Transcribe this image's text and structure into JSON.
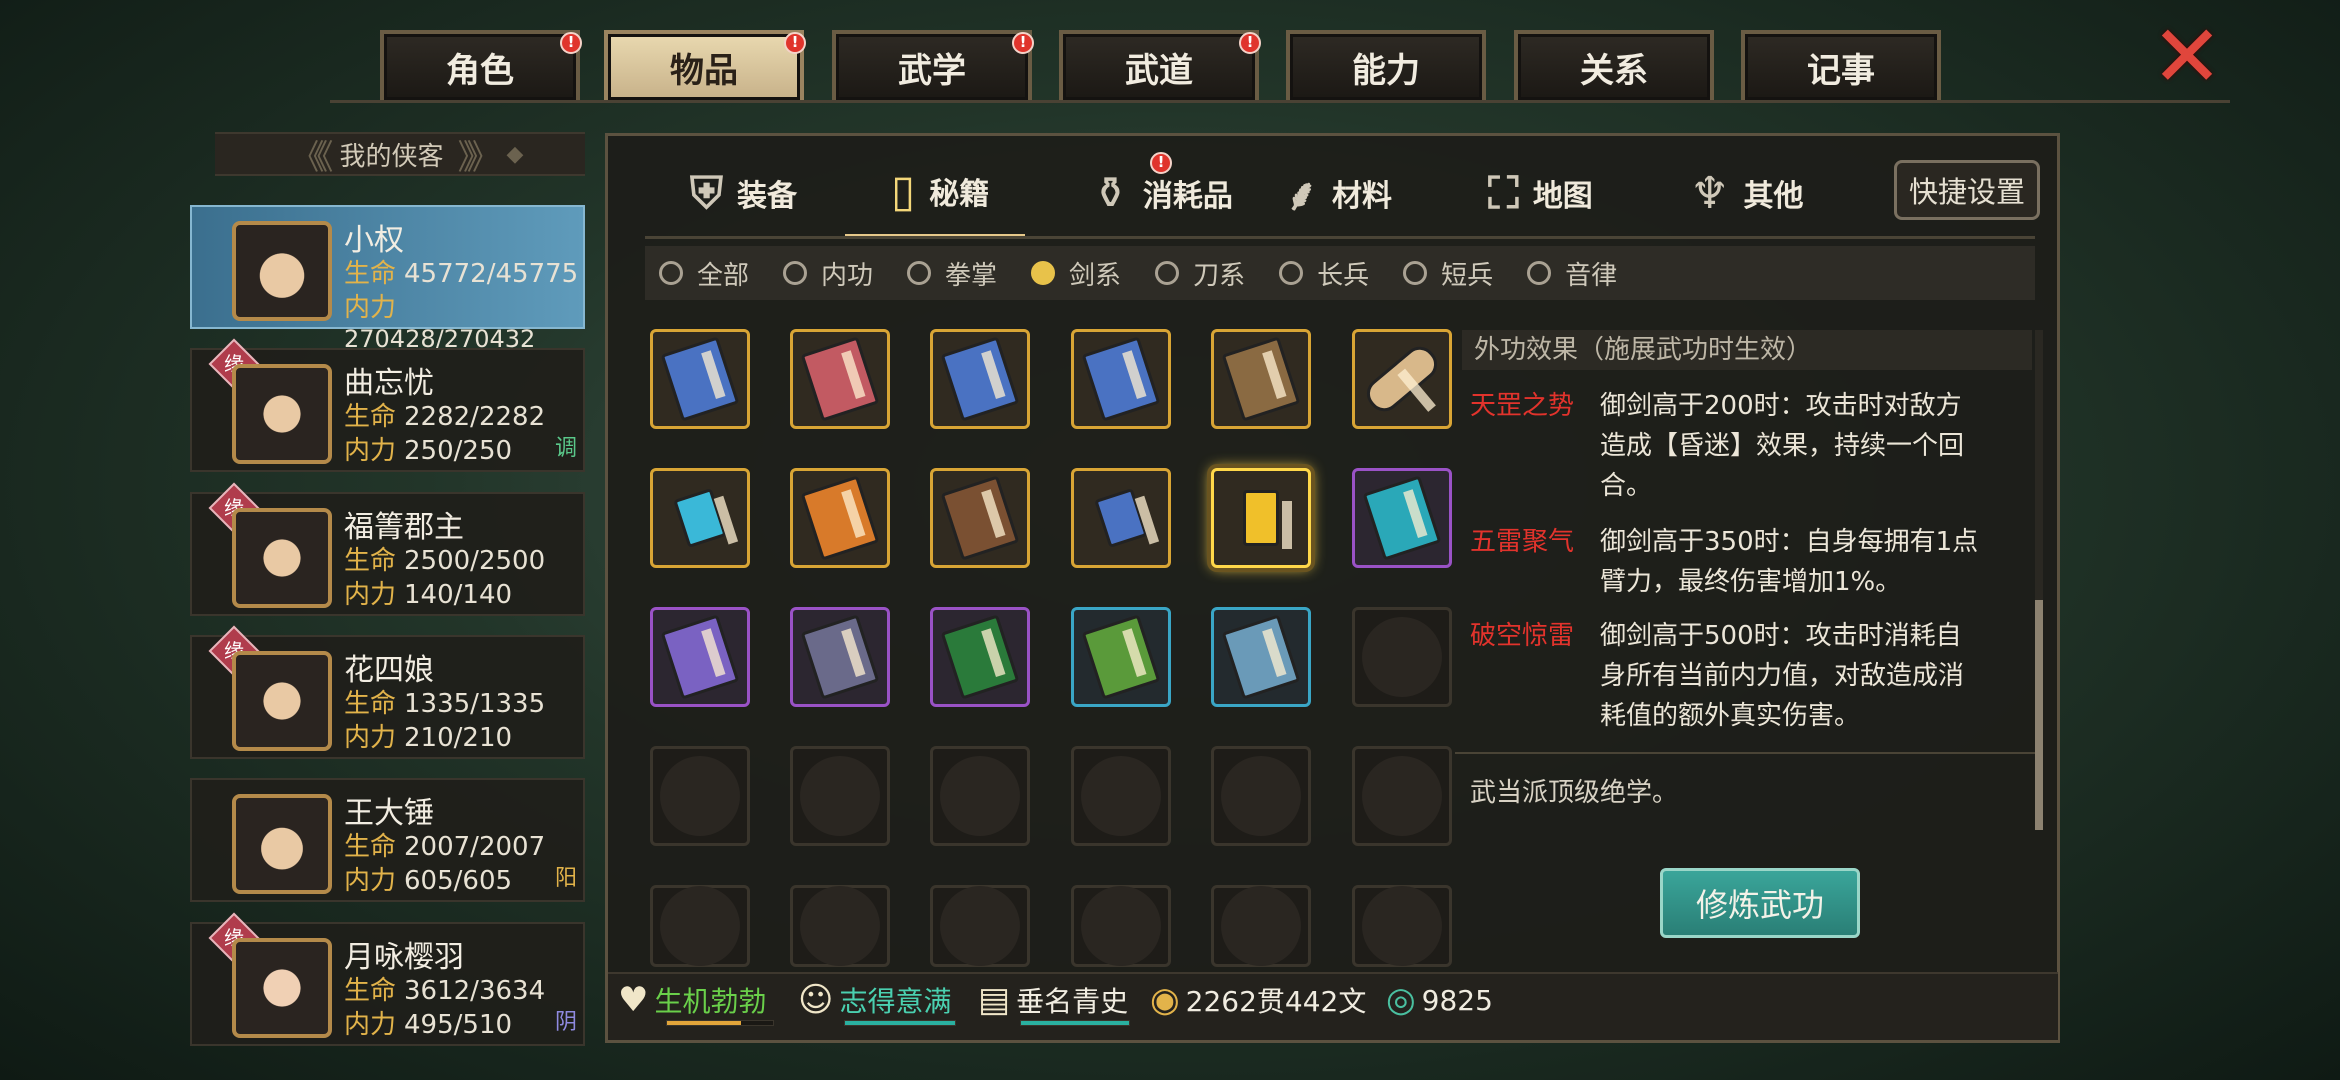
{
  "top_tabs": [
    {
      "label": "角色",
      "alert": "!"
    },
    {
      "label": "物品",
      "alert": "!"
    },
    {
      "label": "武学",
      "alert": "!"
    },
    {
      "label": "武道",
      "alert": "!"
    },
    {
      "label": "能力",
      "alert": ""
    },
    {
      "label": "关系",
      "alert": ""
    },
    {
      "label": "记事",
      "alert": ""
    }
  ],
  "close_icon": "close-icon",
  "sidebar": {
    "title": "我的侠客",
    "characters": [
      {
        "name": "小权",
        "hp_label": "生命",
        "hp": "45772/45775",
        "mp_label": "内力",
        "mp": "270428/270432",
        "tag": "",
        "badge": ""
      },
      {
        "name": "曲忘忧",
        "hp_label": "生命",
        "hp": "2282/2282",
        "mp_label": "内力",
        "mp": "250/250",
        "tag": "调",
        "badge": "缘"
      },
      {
        "name": "福箐郡主",
        "hp_label": "生命",
        "hp": "2500/2500",
        "mp_label": "内力",
        "mp": "140/140",
        "tag": "",
        "badge": "缘"
      },
      {
        "name": "花四娘",
        "hp_label": "生命",
        "hp": "1335/1335",
        "mp_label": "内力",
        "mp": "210/210",
        "tag": "",
        "badge": "缘"
      },
      {
        "name": "王大锤",
        "hp_label": "生命",
        "hp": "2007/2007",
        "mp_label": "内力",
        "mp": "605/605",
        "tag": "阳",
        "badge": ""
      },
      {
        "name": "月咏樱羽",
        "hp_label": "生命",
        "hp": "3612/3634",
        "mp_label": "内力",
        "mp": "495/510",
        "tag": "阴",
        "badge": "缘"
      }
    ]
  },
  "sub_tabs": [
    {
      "label": "装备",
      "icon": "armor-icon"
    },
    {
      "label": "秘籍",
      "icon": "book-icon"
    },
    {
      "label": "消耗品",
      "icon": "potion-icon",
      "alert": "!"
    },
    {
      "label": "材料",
      "icon": "herb-icon"
    },
    {
      "label": "地图",
      "icon": "map-icon"
    },
    {
      "label": "其他",
      "icon": "misc-icon"
    }
  ],
  "shortcut_label": "快捷设置",
  "filters": [
    "全部",
    "内功",
    "拳掌",
    "剑系",
    "刀系",
    "长兵",
    "短兵",
    "音律"
  ],
  "selected_filter": "剑系",
  "colors": {
    "gold": "#d9a535",
    "purple": "#9a52c6",
    "cyan": "#3aa6c6",
    "red_effect": "#e2332c",
    "accent_button": "#2f8f84"
  },
  "detail": {
    "header": "外功效果（施展武功时生效）",
    "effects": [
      {
        "name": "天罡之势",
        "lines": [
          "御剑高于200时：攻击时对敌方",
          "造成【昏迷】效果，持续一个回",
          "合。"
        ]
      },
      {
        "name": "五雷聚气",
        "lines": [
          "御剑高于350时：自身每拥有1点",
          "臂力，最终伤害增加1%。"
        ]
      },
      {
        "name": "破空惊雷",
        "lines": [
          "御剑高于500时：攻击时消耗自",
          "身所有当前内力值，对敌造成消",
          "耗值的额外真实伤害。"
        ]
      }
    ],
    "description": "武当派顶级绝学。",
    "train_button": "修炼武功"
  },
  "status": {
    "vitality": "生机勃勃",
    "mood": "志得意满",
    "fame": "垂名青史",
    "money": "2262贯442文",
    "jade": "9825"
  }
}
